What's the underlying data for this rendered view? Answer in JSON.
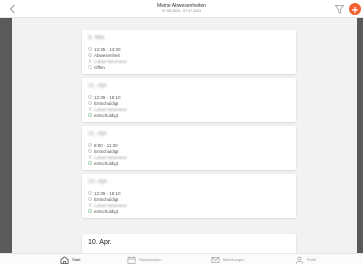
{
  "header": {
    "title": "Meine Abwesenheiten",
    "subtitle": "07.08.2023 - 07.07.2024"
  },
  "colors": {
    "accent": "#f2612e"
  },
  "cards": [
    {
      "date": "8. Mai",
      "rows": [
        {
          "icon": "clock-icon",
          "text": "12:35 - 14:20"
        },
        {
          "icon": "info-icon",
          "text": "Abwesenheit"
        },
        {
          "icon": "person-icon",
          "text": "Lukas Neumann",
          "blurred": true
        },
        {
          "icon": "circle-icon",
          "text": "Offen"
        }
      ]
    },
    {
      "date": "11. Apr.",
      "rows": [
        {
          "icon": "clock-icon",
          "text": "12:35 - 15:10"
        },
        {
          "icon": "info-icon",
          "text": "Entschuldigt"
        },
        {
          "icon": "person-icon",
          "text": "Lukas Neumann",
          "blurred": true
        },
        {
          "icon": "check-circle-icon",
          "text": "entschuldigt"
        }
      ]
    },
    {
      "date": "11. Apr.",
      "rows": [
        {
          "icon": "clock-icon",
          "text": "8:00 - 11:30"
        },
        {
          "icon": "info-icon",
          "text": "Entschuldigt"
        },
        {
          "icon": "person-icon",
          "text": "Lukas Neumann",
          "blurred": true
        },
        {
          "icon": "check-circle-icon",
          "text": "entschuldigt"
        }
      ]
    },
    {
      "date": "10. Apr.",
      "rows": [
        {
          "icon": "clock-icon",
          "text": "12:35 - 15:10"
        },
        {
          "icon": "info-icon",
          "text": "Entschuldigt"
        },
        {
          "icon": "person-icon",
          "text": "Lukas Neumann",
          "blurred": true
        },
        {
          "icon": "check-circle-icon",
          "text": "entschuldigt"
        }
      ]
    },
    {
      "date": "10. Apr.",
      "rows": []
    }
  ],
  "tabs": [
    {
      "label": "Start",
      "icon": "home-icon",
      "active": true
    },
    {
      "label": "Stundenplan",
      "icon": "calendar-icon",
      "active": false
    },
    {
      "label": "Mitteilungen",
      "icon": "mail-icon",
      "active": false
    },
    {
      "label": "Profil",
      "icon": "person-icon",
      "active": false
    }
  ]
}
